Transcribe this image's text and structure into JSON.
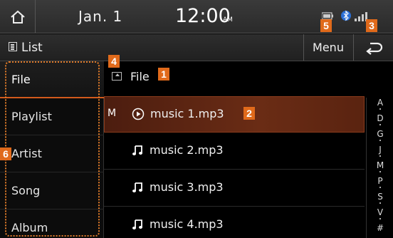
{
  "status": {
    "date": "Jan.  1",
    "time": "12:00",
    "ampm": "AM"
  },
  "header": {
    "title": "List",
    "menu_label": "Menu"
  },
  "sidebar": {
    "items": [
      {
        "label": "File"
      },
      {
        "label": "Playlist"
      },
      {
        "label": "Artist"
      },
      {
        "label": "Song"
      },
      {
        "label": "Album"
      }
    ]
  },
  "main": {
    "path_label": "File",
    "rows": [
      {
        "marker": "M",
        "name": "music 1.mp3",
        "playing": true
      },
      {
        "marker": "",
        "name": "music 2.mp3",
        "playing": false
      },
      {
        "marker": "",
        "name": "music 3.mp3",
        "playing": false
      },
      {
        "marker": "",
        "name": "music 4.mp3",
        "playing": false
      }
    ]
  },
  "alpha_index": [
    "A",
    "D",
    "G",
    "J",
    "M",
    "P",
    "S",
    "V",
    "#"
  ],
  "callouts": [
    "1",
    "2",
    "3",
    "4",
    "5",
    "6"
  ],
  "colors": {
    "accent": "#e06a1b",
    "playing_row": "#5a2310",
    "background": "#000000"
  }
}
